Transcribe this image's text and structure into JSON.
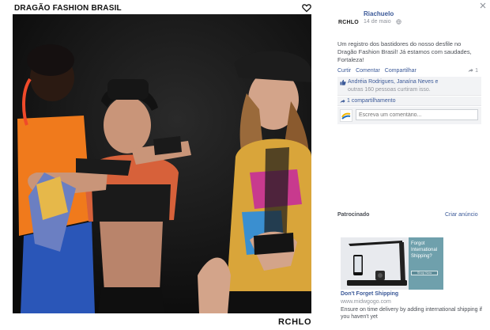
{
  "photo": {
    "title": "DRAGÃO FASHION BRASIL",
    "brand_footer": "RCHLO",
    "icons": {
      "heart": "heart-icon"
    }
  },
  "sidebar": {
    "page_logo": "RCHLO",
    "page_name": "Riachuelo",
    "post_date": "14 de maio",
    "post_text": "Um registro dos bastidores do nosso desfile no Dragão Fashion Brasil! Já estamos com saudades, Fortaleza!",
    "actions": {
      "like": "Curtir",
      "comment": "Comentar",
      "share": "Compartilhar",
      "share_count": "1"
    },
    "reactions": {
      "names": "Andréia Rodrigues, Janaína Neves e",
      "others": "outras 160 pessoas curtiram isso."
    },
    "shares": "1 compartilhamento",
    "comment_placeholder": "Escreva um comentário...",
    "sponsored": {
      "label": "Patrocinado",
      "create_ad": "Criar anúncio",
      "image_overlay": "Forgot International Shipping?",
      "image_cta": "Shop Now",
      "title": "Don't Forget Shipping",
      "url": "www.midwgogo.com",
      "description": "Ensure on time delivery by adding international shipping if you haven't yet"
    }
  },
  "colors": {
    "link": "#3b5998",
    "muted": "#90949c",
    "ad_panel": "#6fa0ac"
  }
}
